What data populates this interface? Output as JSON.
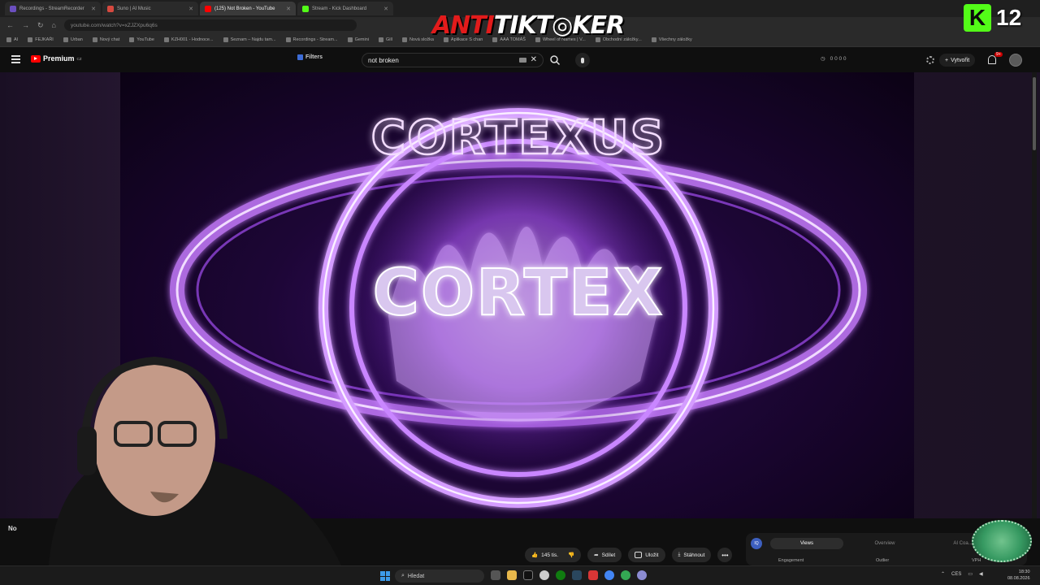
{
  "browser": {
    "tabs": [
      {
        "title": "Recordings - StreamRecorder",
        "favicon_color": "#6b4fbf",
        "active": false
      },
      {
        "title": "Suno | AI Music",
        "favicon_color": "#d6493f",
        "active": false
      },
      {
        "title": "(125) Not Broken - YouTube",
        "favicon_color": "#ff0000",
        "active": true
      },
      {
        "title": "Stream - Kick Dashboard",
        "favicon_color": "#53fc18",
        "active": false
      }
    ],
    "url": "youtube.com/watch?v=xZJZXpu6q6s",
    "bookmarks": [
      "AI",
      "FEJKAŘI",
      "Urban",
      "Nový chat",
      "YouTube",
      "KZH001 - Hodnoce...",
      "Seznam – Najdu tam...",
      "Recordings - Stream...",
      "Gemini",
      "Gill",
      "Nová složka",
      "Aplikace S chan",
      "AAA TOMÁŠ",
      "Wheel of Names | V...",
      "Obchodní záložky...",
      "Všechny záložky"
    ]
  },
  "overlay": {
    "logo_part1": "ANTI",
    "logo_part2": "TIKT◎KER",
    "kick_logo": "K",
    "viewer_count": "12"
  },
  "youtube": {
    "brand": "Premium",
    "region": "CZ",
    "filters_label": "Filters",
    "search_value": "not broken",
    "header_stats": "0 0 0 0",
    "create_label": "Vytvořit",
    "notifications_badge": "9+"
  },
  "video": {
    "ring_text": "CORTEXUS",
    "center_text": "CORTEX",
    "accent_color": "#b14cff"
  },
  "actions": {
    "likes": "145 tis.",
    "share": "Sdílet",
    "save": "Uložit",
    "download": "Stáhnout"
  },
  "analytics_panel": {
    "icon": "IQ",
    "tabs": [
      "Views",
      "Overview",
      "AI Coa..."
    ],
    "labels": [
      "Engagement",
      "Outlier",
      "VPH"
    ]
  },
  "webcam": {
    "caption": "No"
  },
  "taskbar": {
    "search_placeholder": "Hledat",
    "language": "CES",
    "time": "18:30",
    "date": "08.08.2026"
  }
}
